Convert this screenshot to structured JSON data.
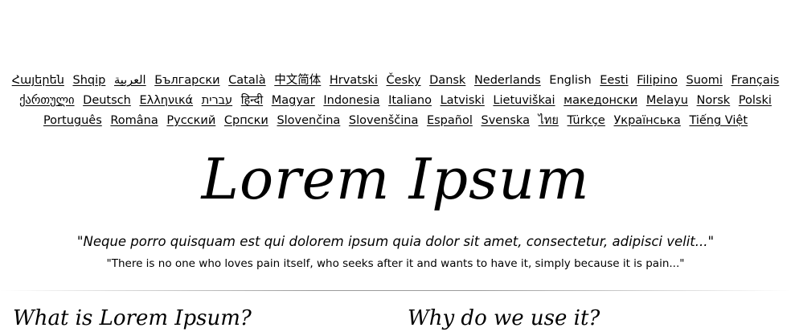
{
  "languages": {
    "row1": [
      {
        "label": "Հայերեն",
        "current": false
      },
      {
        "label": "Shqip",
        "current": false
      },
      {
        "label": "العربية",
        "current": false
      },
      {
        "label": "Български",
        "current": false
      },
      {
        "label": "Català",
        "current": false
      },
      {
        "label": "中文简体",
        "current": false
      },
      {
        "label": "Hrvatski",
        "current": false
      },
      {
        "label": "Česky",
        "current": false
      },
      {
        "label": "Dansk",
        "current": false
      },
      {
        "label": "Nederlands",
        "current": false
      },
      {
        "label": "English",
        "current": true
      },
      {
        "label": "Eesti",
        "current": false
      },
      {
        "label": "Filipino",
        "current": false
      },
      {
        "label": "Suomi",
        "current": false
      },
      {
        "label": "Français",
        "current": false
      }
    ],
    "row2": [
      {
        "label": "ქართული",
        "current": false
      },
      {
        "label": "Deutsch",
        "current": false
      },
      {
        "label": "Ελληνικά",
        "current": false
      },
      {
        "label": "עברית",
        "current": false
      },
      {
        "label": "हिन्दी",
        "current": false
      },
      {
        "label": "Magyar",
        "current": false
      },
      {
        "label": "Indonesia",
        "current": false
      },
      {
        "label": "Italiano",
        "current": false
      },
      {
        "label": "Latviski",
        "current": false
      },
      {
        "label": "Lietuviškai",
        "current": false
      },
      {
        "label": "македонски",
        "current": false
      },
      {
        "label": "Melayu",
        "current": false
      },
      {
        "label": "Norsk",
        "current": false
      },
      {
        "label": "Polski",
        "current": false
      }
    ],
    "row3": [
      {
        "label": "Português",
        "current": false
      },
      {
        "label": "Româna",
        "current": false
      },
      {
        "label": "Pyccкий",
        "current": false
      },
      {
        "label": "Српски",
        "current": false
      },
      {
        "label": "Slovenčina",
        "current": false
      },
      {
        "label": "Slovenščina",
        "current": false
      },
      {
        "label": "Español",
        "current": false
      },
      {
        "label": "Svenska",
        "current": false
      },
      {
        "label": "ไทย",
        "current": false
      },
      {
        "label": "Türkçe",
        "current": false
      },
      {
        "label": "Українська",
        "current": false
      },
      {
        "label": "Tiếng Việt",
        "current": false
      }
    ]
  },
  "header": {
    "logo_text": "Lorem Ipsum",
    "quote_latin": "\"Neque porro quisquam est qui dolorem ipsum quia dolor sit amet, consectetur, adipisci velit...\"",
    "quote_english": "\"There is no one who loves pain itself, who seeks after it and wants to have it, simply because it is pain...\""
  },
  "sections": {
    "left_heading": "What is Lorem Ipsum?",
    "right_heading": "Why do we use it?"
  }
}
